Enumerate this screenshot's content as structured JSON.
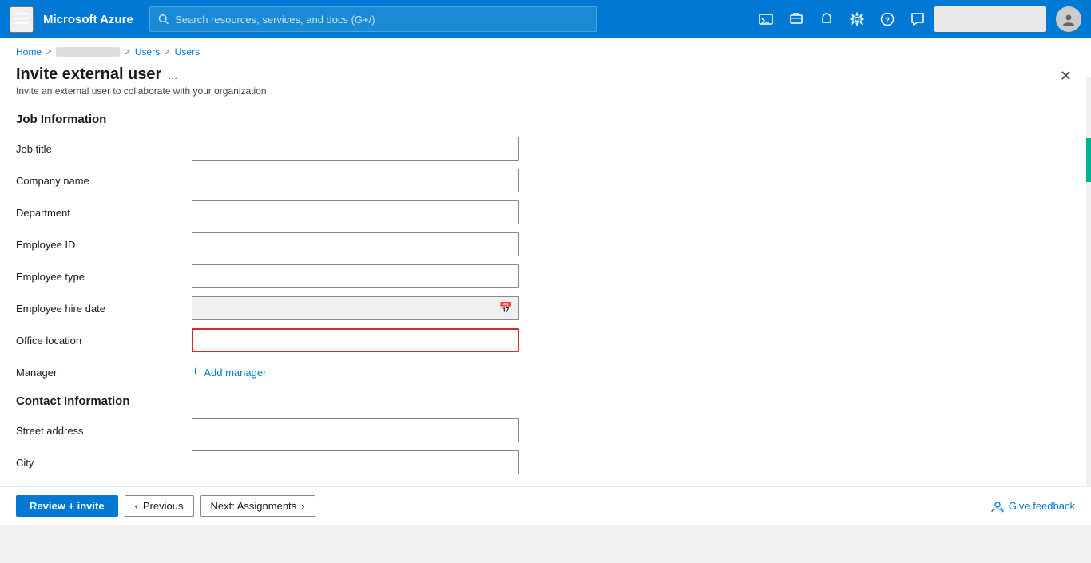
{
  "topbar": {
    "logo": "Microsoft Azure",
    "search_placeholder": "Search resources, services, and docs (G+/)",
    "hamburger_icon": "≡",
    "search_icon": "🔍",
    "icons": [
      "📺",
      "📥",
      "🔔",
      "⚙",
      "❓",
      "👥"
    ]
  },
  "breadcrumb": {
    "home": "Home",
    "sep1": ">",
    "blurred": "",
    "sep2": ">",
    "users1": "Users",
    "sep3": ">",
    "users2": "Users"
  },
  "page": {
    "title": "Invite external user",
    "ellipsis": "...",
    "subtitle": "Invite an external user to collaborate with your organization",
    "close_icon": "✕"
  },
  "form": {
    "job_section": "Job Information",
    "fields": [
      {
        "label": "Job title",
        "type": "text",
        "value": "",
        "highlighted": false
      },
      {
        "label": "Company name",
        "type": "text",
        "value": "",
        "highlighted": false
      },
      {
        "label": "Department",
        "type": "text",
        "value": "",
        "highlighted": false
      },
      {
        "label": "Employee ID",
        "type": "text",
        "value": "",
        "highlighted": false
      },
      {
        "label": "Employee type",
        "type": "text",
        "value": "",
        "highlighted": false
      },
      {
        "label": "Employee hire date",
        "type": "date",
        "value": "",
        "highlighted": false
      },
      {
        "label": "Office location",
        "type": "text",
        "value": "",
        "highlighted": true
      }
    ],
    "manager_label": "Manager",
    "add_manager_label": "Add manager",
    "contact_section": "Contact Information",
    "contact_fields": [
      {
        "label": "Street address",
        "type": "text",
        "value": "",
        "highlighted": false
      },
      {
        "label": "City",
        "type": "text",
        "value": "",
        "highlighted": false
      }
    ]
  },
  "actions": {
    "review_invite": "Review + invite",
    "previous_chevron": "‹",
    "previous": "Previous",
    "next": "Next: Assignments",
    "next_chevron": "›",
    "feedback_icon": "👤",
    "give_feedback": "Give feedback"
  }
}
